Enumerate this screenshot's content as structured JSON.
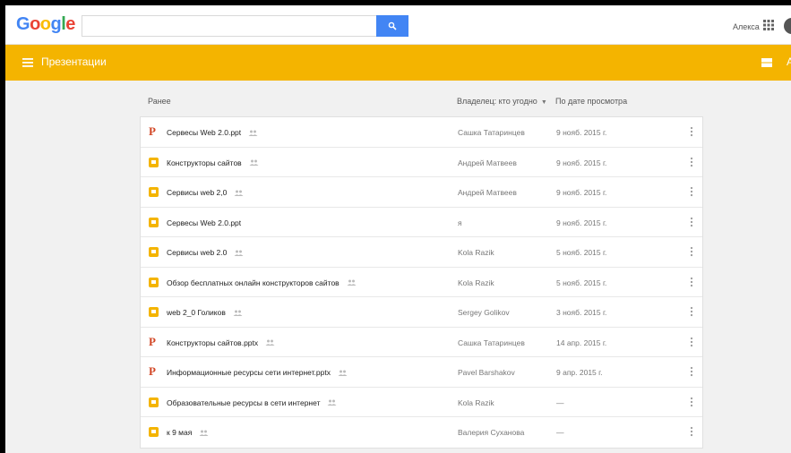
{
  "header": {
    "logo": [
      "G",
      "o",
      "o",
      "g",
      "l",
      "e"
    ],
    "logo_colors": [
      "#4285f4",
      "#ea4335",
      "#fbbc05",
      "#4285f4",
      "#34a853",
      "#ea4335"
    ],
    "search_placeholder": "",
    "user_name": "Алекса"
  },
  "appbar": {
    "title": "Презентации",
    "right_letter": "A",
    "color": "#f4b400"
  },
  "columns": {
    "name": "Ранее",
    "owner": "Владелец: кто угодно",
    "date": "По дате просмотра"
  },
  "files": [
    {
      "type": "ppt",
      "name": "Сервесы Web 2.0.ppt",
      "shared": true,
      "owner": "Сашка Татаринцев",
      "date": "9 нояб. 2015 г."
    },
    {
      "type": "slides",
      "name": "Конструкторы сайтов",
      "shared": true,
      "owner": "Андрей Матвеев",
      "date": "9 нояб. 2015 г."
    },
    {
      "type": "slides",
      "name": "Сервисы web 2,0",
      "shared": true,
      "owner": "Андрей Матвеев",
      "date": "9 нояб. 2015 г."
    },
    {
      "type": "slides",
      "name": "Сервесы Web 2.0.ppt",
      "shared": false,
      "owner": "я",
      "date": "9 нояб. 2015 г."
    },
    {
      "type": "slides",
      "name": "Сервисы web 2.0",
      "shared": true,
      "owner": "Kola Razik",
      "date": "5 нояб. 2015 г."
    },
    {
      "type": "slides",
      "name": "Обзор бесплатных онлайн конструкторов сайтов",
      "shared": true,
      "owner": "Kola Razik",
      "date": "5 нояб. 2015 г."
    },
    {
      "type": "slides",
      "name": "web 2_0 Голиков",
      "shared": true,
      "owner": "Sergey Golikov",
      "date": "3 нояб. 2015 г."
    },
    {
      "type": "ppt",
      "name": "Конструкторы сайтов.pptx",
      "shared": true,
      "owner": "Сашка Татаринцев",
      "date": "14 апр. 2015 г."
    },
    {
      "type": "ppt",
      "name": "Информационные ресурсы сети интернет.pptx",
      "shared": true,
      "owner": "Pavel Barshakov",
      "date": "9 апр. 2015 г."
    },
    {
      "type": "slides",
      "name": "Образовательные ресурсы в сети интернет",
      "shared": true,
      "owner": "Kola Razik",
      "date": "—"
    },
    {
      "type": "slides",
      "name": "к 9 мая",
      "shared": true,
      "owner": "Валерия Суханова",
      "date": "—"
    }
  ]
}
